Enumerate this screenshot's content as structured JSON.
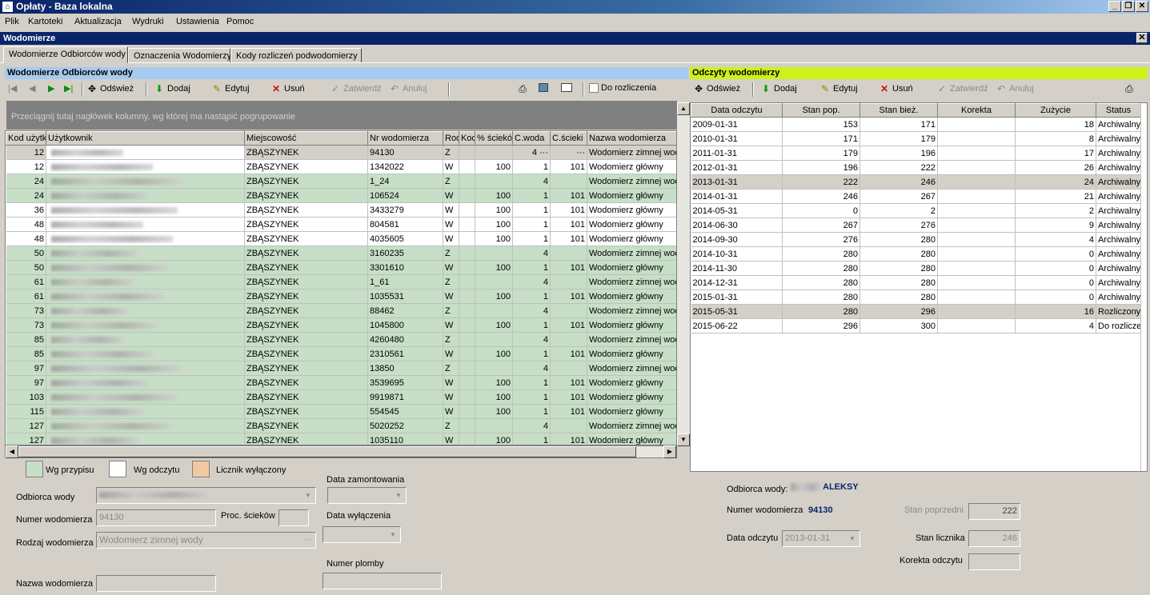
{
  "app": {
    "title": "Opłaty - Baza lokalna"
  },
  "menu": [
    "Plik",
    "Kartoteki",
    "Aktualizacja",
    "Wydruki",
    "Ustawienia",
    "Pomoc"
  ],
  "child_window": {
    "title": "Wodomierze"
  },
  "tabs": [
    "Wodomierze Odbiorców wody",
    "Oznaczenia Wodomierzy",
    "Kody rozliczeń podwodomierzy"
  ],
  "left_panel": {
    "title": "Wodomierze Odbiorców wody",
    "toolbar": {
      "refresh": "Odśwież",
      "add": "Dodaj",
      "edit": "Edytuj",
      "delete": "Usuń",
      "confirm": "Zatwierdź",
      "cancel": "Anuluj",
      "for_settlement": "Do rozliczenia"
    },
    "group_hint": "Przeciągnij tutaj nagłówek kolumny, wg której ma nastąpić pogrupowanie",
    "columns": [
      "Kod użytk",
      "Użytkownik",
      "Miejscowość",
      "Nr wodomierza",
      "Rod",
      "Kod",
      "% ścieków",
      "C.woda",
      "C.ścieki",
      "Nazwa wodomierza"
    ],
    "rows": [
      {
        "kod": "12",
        "miej": "ZBĄSZYNEK",
        "nr": "94130",
        "rod": "Z",
        "proc": "",
        "cw": "4 ···",
        "cs": "···",
        "nazwa": "Wodomierz zimnej wod",
        "st": "gray"
      },
      {
        "kod": "12",
        "miej": "ZBĄSZYNEK",
        "nr": "1342022",
        "rod": "W",
        "proc": "100",
        "cw": "1",
        "cs": "101",
        "nazwa": "Wodomierz główny",
        "st": "white"
      },
      {
        "kod": "24",
        "miej": "ZBĄSZYNEK",
        "nr": "1_24",
        "rod": "Z",
        "proc": "",
        "cw": "4",
        "cs": "",
        "nazwa": "Wodomierz zimnej wod",
        "st": "green"
      },
      {
        "kod": "24",
        "miej": "ZBĄSZYNEK",
        "nr": "106524",
        "rod": "W",
        "proc": "100",
        "cw": "1",
        "cs": "101",
        "nazwa": "Wodomierz główny",
        "st": "green"
      },
      {
        "kod": "36",
        "miej": "ZBĄSZYNEK",
        "nr": "3433279",
        "rod": "W",
        "proc": "100",
        "cw": "1",
        "cs": "101",
        "nazwa": "Wodomierz główny",
        "st": "white"
      },
      {
        "kod": "48",
        "miej": "ZBĄSZYNEK",
        "nr": "804581",
        "rod": "W",
        "proc": "100",
        "cw": "1",
        "cs": "101",
        "nazwa": "Wodomierz główny",
        "st": "white"
      },
      {
        "kod": "48",
        "miej": "ZBĄSZYNEK",
        "nr": "4035605",
        "rod": "W",
        "proc": "100",
        "cw": "1",
        "cs": "101",
        "nazwa": "Wodomierz główny",
        "st": "white"
      },
      {
        "kod": "50",
        "miej": "ZBĄSZYNEK",
        "nr": "3160235",
        "rod": "Z",
        "proc": "",
        "cw": "4",
        "cs": "",
        "nazwa": "Wodomierz zimnej wod",
        "st": "green"
      },
      {
        "kod": "50",
        "miej": "ZBĄSZYNEK",
        "nr": "3301610",
        "rod": "W",
        "proc": "100",
        "cw": "1",
        "cs": "101",
        "nazwa": "Wodomierz główny",
        "st": "green"
      },
      {
        "kod": "61",
        "miej": "ZBĄSZYNEK",
        "nr": "1_61",
        "rod": "Z",
        "proc": "",
        "cw": "4",
        "cs": "",
        "nazwa": "Wodomierz zimnej wod",
        "st": "green"
      },
      {
        "kod": "61",
        "miej": "ZBĄSZYNEK",
        "nr": "1035531",
        "rod": "W",
        "proc": "100",
        "cw": "1",
        "cs": "101",
        "nazwa": "Wodomierz główny",
        "st": "green"
      },
      {
        "kod": "73",
        "miej": "ZBĄSZYNEK",
        "nr": "88462",
        "rod": "Z",
        "proc": "",
        "cw": "4",
        "cs": "",
        "nazwa": "Wodomierz zimnej wod",
        "st": "green"
      },
      {
        "kod": "73",
        "miej": "ZBĄSZYNEK",
        "nr": "1045800",
        "rod": "W",
        "proc": "100",
        "cw": "1",
        "cs": "101",
        "nazwa": "Wodomierz główny",
        "st": "green"
      },
      {
        "kod": "85",
        "miej": "ZBĄSZYNEK",
        "nr": "4260480",
        "rod": "Z",
        "proc": "",
        "cw": "4",
        "cs": "",
        "nazwa": "Wodomierz zimnej wod",
        "st": "green"
      },
      {
        "kod": "85",
        "miej": "ZBĄSZYNEK",
        "nr": "2310561",
        "rod": "W",
        "proc": "100",
        "cw": "1",
        "cs": "101",
        "nazwa": "Wodomierz główny",
        "st": "green"
      },
      {
        "kod": "97",
        "miej": "ZBĄSZYNEK",
        "nr": "13850",
        "rod": "Z",
        "proc": "",
        "cw": "4",
        "cs": "",
        "nazwa": "Wodomierz zimnej wod",
        "st": "green"
      },
      {
        "kod": "97",
        "miej": "ZBĄSZYNEK",
        "nr": "3539695",
        "rod": "W",
        "proc": "100",
        "cw": "1",
        "cs": "101",
        "nazwa": "Wodomierz główny",
        "st": "green"
      },
      {
        "kod": "103",
        "miej": "ZBĄSZYNEK",
        "nr": "9919871",
        "rod": "W",
        "proc": "100",
        "cw": "1",
        "cs": "101",
        "nazwa": "Wodomierz główny",
        "st": "green"
      },
      {
        "kod": "115",
        "miej": "ZBĄSZYNEK",
        "nr": "554545",
        "rod": "W",
        "proc": "100",
        "cw": "1",
        "cs": "101",
        "nazwa": "Wodomierz główny",
        "st": "green"
      },
      {
        "kod": "127",
        "miej": "ZBĄSZYNEK",
        "nr": "5020252",
        "rod": "Z",
        "proc": "",
        "cw": "4",
        "cs": "",
        "nazwa": "Wodomierz zimnej wod",
        "st": "green"
      },
      {
        "kod": "127",
        "miej": "ZBĄSZYNEK",
        "nr": "1035110",
        "rod": "W",
        "proc": "100",
        "cw": "1",
        "cs": "101",
        "nazwa": "Wodomierz główny",
        "st": "green"
      }
    ]
  },
  "legend": {
    "wg_przypisu": "Wg przypisu",
    "wg_odczytu": "Wg odczytu",
    "licznik": "Licznik wyłączony",
    "colors": {
      "wg_przypisu": "#c6dfc6",
      "wg_odczytu": "#ffffff",
      "licznik": "#f2c8a0"
    }
  },
  "form_left": {
    "odbiorca_label": "Odbiorca wody",
    "numer_label": "Numer wodomierza",
    "numer_value": "94130",
    "proc_label": "Proc. ścieków",
    "rodzaj_label": "Rodzaj wodomierza",
    "rodzaj_value": "Wodomierz zimnej wody",
    "nazwa_label": "Nazwa wodomierza",
    "data_mont_label": "Data zamontowania",
    "data_wyl_label": "Data wyłączenia",
    "plomba_label": "Numer plomby"
  },
  "right_panel": {
    "title": "Odczyty wodomierzy",
    "toolbar": {
      "refresh": "Odśwież",
      "add": "Dodaj",
      "edit": "Edytuj",
      "delete": "Usuń",
      "confirm": "Zatwierdź",
      "cancel": "Anuluj"
    },
    "columns": [
      "Data odczytu",
      "Stan pop.",
      "Stan bież.",
      "Korekta",
      "Zużycie",
      "Status"
    ],
    "rows": [
      {
        "d": "2009-01-31",
        "p": "153",
        "b": "171",
        "k": "",
        "z": "18",
        "s": "Archiwalny",
        "st": "white"
      },
      {
        "d": "2010-01-31",
        "p": "171",
        "b": "179",
        "k": "",
        "z": "8",
        "s": "Archiwalny",
        "st": "white"
      },
      {
        "d": "2011-01-31",
        "p": "179",
        "b": "196",
        "k": "",
        "z": "17",
        "s": "Archiwalny",
        "st": "white"
      },
      {
        "d": "2012-01-31",
        "p": "196",
        "b": "222",
        "k": "",
        "z": "26",
        "s": "Archiwalny",
        "st": "white"
      },
      {
        "d": "2013-01-31",
        "p": "222",
        "b": "246",
        "k": "",
        "z": "24",
        "s": "Archiwalny",
        "st": "gray"
      },
      {
        "d": "2014-01-31",
        "p": "246",
        "b": "267",
        "k": "",
        "z": "21",
        "s": "Archiwalny",
        "st": "white"
      },
      {
        "d": "2014-05-31",
        "p": "0",
        "b": "2",
        "k": "",
        "z": "2",
        "s": "Archiwalny",
        "st": "white"
      },
      {
        "d": "2014-06-30",
        "p": "267",
        "b": "276",
        "k": "",
        "z": "9",
        "s": "Archiwalny",
        "st": "white"
      },
      {
        "d": "2014-09-30",
        "p": "276",
        "b": "280",
        "k": "",
        "z": "4",
        "s": "Archiwalny",
        "st": "white"
      },
      {
        "d": "2014-10-31",
        "p": "280",
        "b": "280",
        "k": "",
        "z": "0",
        "s": "Archiwalny",
        "st": "white"
      },
      {
        "d": "2014-11-30",
        "p": "280",
        "b": "280",
        "k": "",
        "z": "0",
        "s": "Archiwalny",
        "st": "white"
      },
      {
        "d": "2014-12-31",
        "p": "280",
        "b": "280",
        "k": "",
        "z": "0",
        "s": "Archiwalny",
        "st": "white"
      },
      {
        "d": "2015-01-31",
        "p": "280",
        "b": "280",
        "k": "",
        "z": "0",
        "s": "Archiwalny",
        "st": "white"
      },
      {
        "d": "2015-05-31",
        "p": "280",
        "b": "296",
        "k": "",
        "z": "16",
        "s": "Rozliczony",
        "st": "gray"
      },
      {
        "d": "2015-06-22",
        "p": "296",
        "b": "300",
        "k": "",
        "z": "4",
        "s": "Do rozlicze",
        "st": "white"
      }
    ]
  },
  "form_right": {
    "odbiorca_label": "Odbiorca wody:",
    "odbiorca_value": "ALEKSY",
    "numer_label": "Numer wodomierza",
    "numer_value": "94130",
    "data_label": "Data odczytu",
    "data_value": "2013-01-31",
    "stan_pop_label": "Stan poprzedni",
    "stan_pop_value": "222",
    "stan_licz_label": "Stan licznika",
    "stan_licz_value": "246",
    "korekta_label": "Korekta odczytu"
  }
}
